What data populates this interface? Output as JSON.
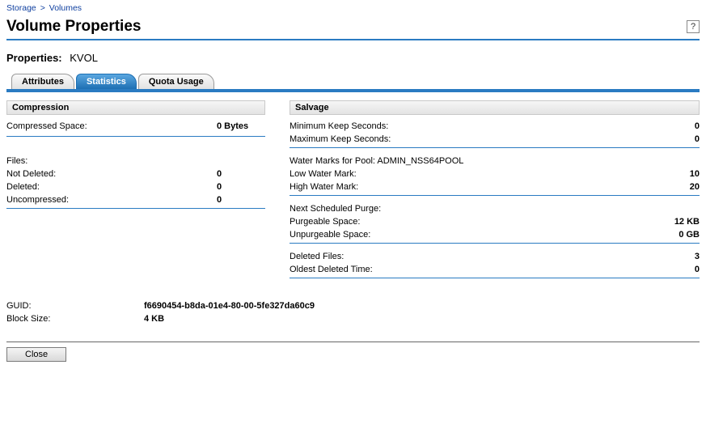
{
  "breadcrumb": {
    "root": "Storage",
    "current": "Volumes"
  },
  "page_title": "Volume Properties",
  "properties_label": "Properties:",
  "volume_name": "KVOL",
  "tabs": {
    "attributes": "Attributes",
    "statistics": "Statistics",
    "quota": "Quota Usage"
  },
  "compression": {
    "header": "Compression",
    "compressed_space_label": "Compressed Space:",
    "compressed_space_value": "0 Bytes",
    "files_label": "Files:",
    "not_deleted_label": "Not Deleted:",
    "not_deleted_value": "0",
    "deleted_label": "Deleted:",
    "deleted_value": "0",
    "uncompressed_label": "Uncompressed:",
    "uncompressed_value": "0"
  },
  "salvage": {
    "header": "Salvage",
    "min_keep_label": "Minimum Keep Seconds:",
    "min_keep_value": "0",
    "max_keep_label": "Maximum Keep Seconds:",
    "max_keep_value": "0",
    "watermarks_label": "Water Marks for Pool: ADMIN_NSS64POOL",
    "low_wm_label": "Low Water Mark:",
    "low_wm_value": "10",
    "high_wm_label": "High Water Mark:",
    "high_wm_value": "20",
    "next_purge_label": "Next Scheduled Purge:",
    "purgeable_label": "Purgeable Space:",
    "purgeable_value": "12 KB",
    "unpurgeable_label": "Unpurgeable Space:",
    "unpurgeable_value": "0 GB",
    "deleted_files_label": "Deleted Files:",
    "deleted_files_value": "3",
    "oldest_deleted_label": "Oldest Deleted Time:",
    "oldest_deleted_value": "0"
  },
  "footer": {
    "guid_label": "GUID:",
    "guid_value": "f6690454-b8da-01e4-80-00-5fe327da60c9",
    "block_size_label": "Block Size:",
    "block_size_value": "4 KB"
  },
  "close_label": "Close"
}
